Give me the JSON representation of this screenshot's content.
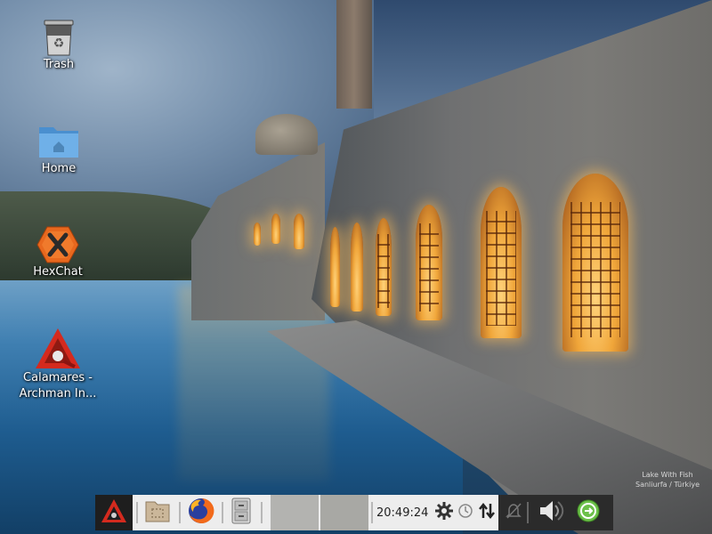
{
  "desktop": {
    "icons": [
      {
        "name": "trash",
        "label": "Trash",
        "icon": "trash-icon"
      },
      {
        "name": "home",
        "label": "Home",
        "icon": "folder-home-icon"
      },
      {
        "name": "hexchat",
        "label": "HexChat",
        "icon": "hexchat-icon"
      },
      {
        "name": "calamares",
        "label": "Calamares -\nArchman In...",
        "icon": "calamares-installer-icon"
      }
    ],
    "wallpaper_caption": {
      "line1": "Lake With Fish",
      "line2": "Sanliurfa / Türkiye"
    }
  },
  "taskbar": {
    "launchers": [
      {
        "name": "menu",
        "icon": "archman-menu-icon"
      },
      {
        "name": "file-manager",
        "icon": "file-manager-icon"
      },
      {
        "name": "firefox",
        "icon": "firefox-icon"
      },
      {
        "name": "archive-manager",
        "icon": "archive-icon"
      }
    ],
    "clock": "20:49:24",
    "tray": [
      {
        "name": "settings",
        "icon": "gear-icon"
      },
      {
        "name": "updates",
        "icon": "clock-icon"
      },
      {
        "name": "network",
        "icon": "network-arrows-icon"
      },
      {
        "name": "notifications-muted",
        "icon": "bell-muted-icon"
      },
      {
        "name": "volume",
        "icon": "speaker-icon"
      },
      {
        "name": "logout",
        "icon": "exit-icon"
      }
    ],
    "colors": {
      "bar": "#ededed",
      "tray": "#2b2b2b",
      "accent_green": "#6cc04a",
      "menu_red": "#d42a1e"
    }
  }
}
